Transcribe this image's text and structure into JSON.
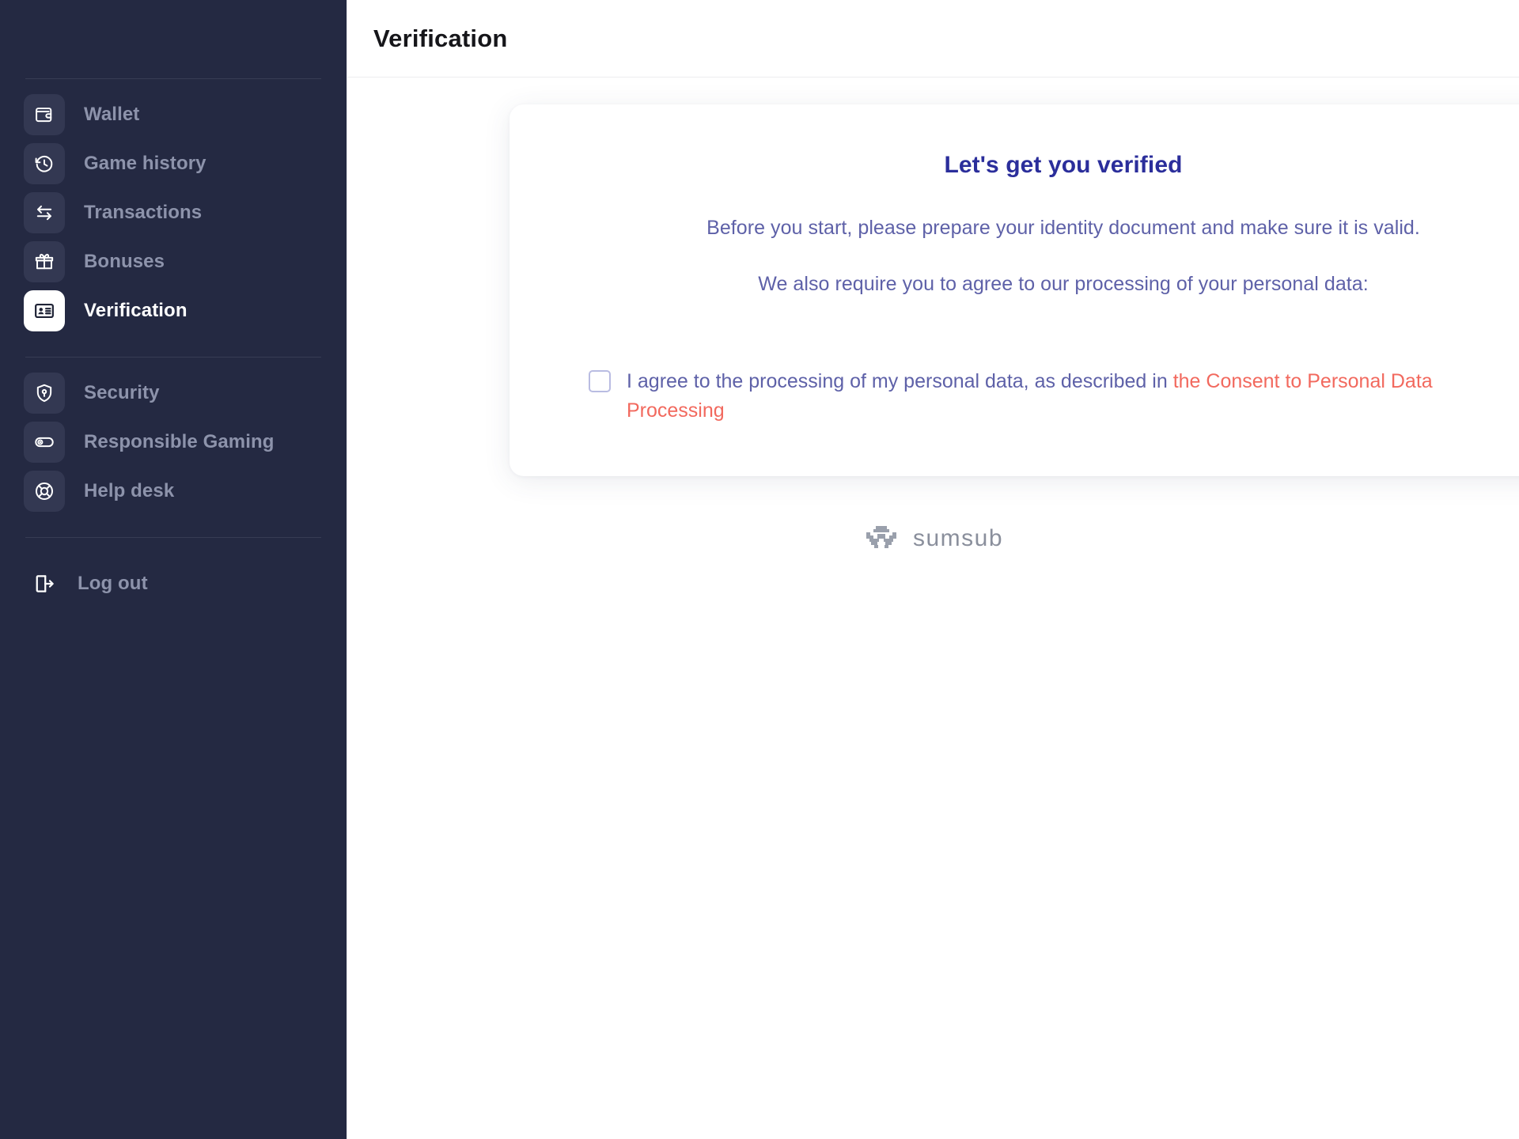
{
  "sidebar": {
    "primary_items": [
      {
        "label": "Wallet",
        "icon": "wallet-icon",
        "active": false
      },
      {
        "label": "Game history",
        "icon": "history-icon",
        "active": false
      },
      {
        "label": "Transactions",
        "icon": "transfer-icon",
        "active": false
      },
      {
        "label": "Bonuses",
        "icon": "gift-icon",
        "active": false
      },
      {
        "label": "Verification",
        "icon": "id-card-icon",
        "active": true
      }
    ],
    "secondary_items": [
      {
        "label": "Security",
        "icon": "shield-lock-icon",
        "active": false
      },
      {
        "label": "Responsible Gaming",
        "icon": "toggle-icon",
        "active": false
      },
      {
        "label": "Help desk",
        "icon": "lifebuoy-icon",
        "active": false
      }
    ],
    "logout": {
      "label": "Log out",
      "icon": "logout-icon"
    }
  },
  "header": {
    "title": "Verification"
  },
  "verification_card": {
    "title": "Let's get you verified",
    "line_1": "Before you start, please prepare your identity document and make sure it is valid.",
    "line_2": "We also require you to agree to our processing of your personal data:",
    "consent": {
      "checked": false,
      "text_before_link": "I agree to the processing of my personal data, as described in ",
      "link_text": "the Consent to Personal Data Processing"
    }
  },
  "branding": {
    "provider_name": "sumsub",
    "provider_icon": "sumsub-mark-icon"
  },
  "colors": {
    "sidebar_bg": "#242942",
    "sidebar_tile": "#333852",
    "sidebar_label": "#8D93AB",
    "sidebar_active_label": "#FFFFFF",
    "card_title": "#2B2E9B",
    "card_text": "#5E61A8",
    "link": "#F2695E",
    "page_title": "#16161A"
  }
}
